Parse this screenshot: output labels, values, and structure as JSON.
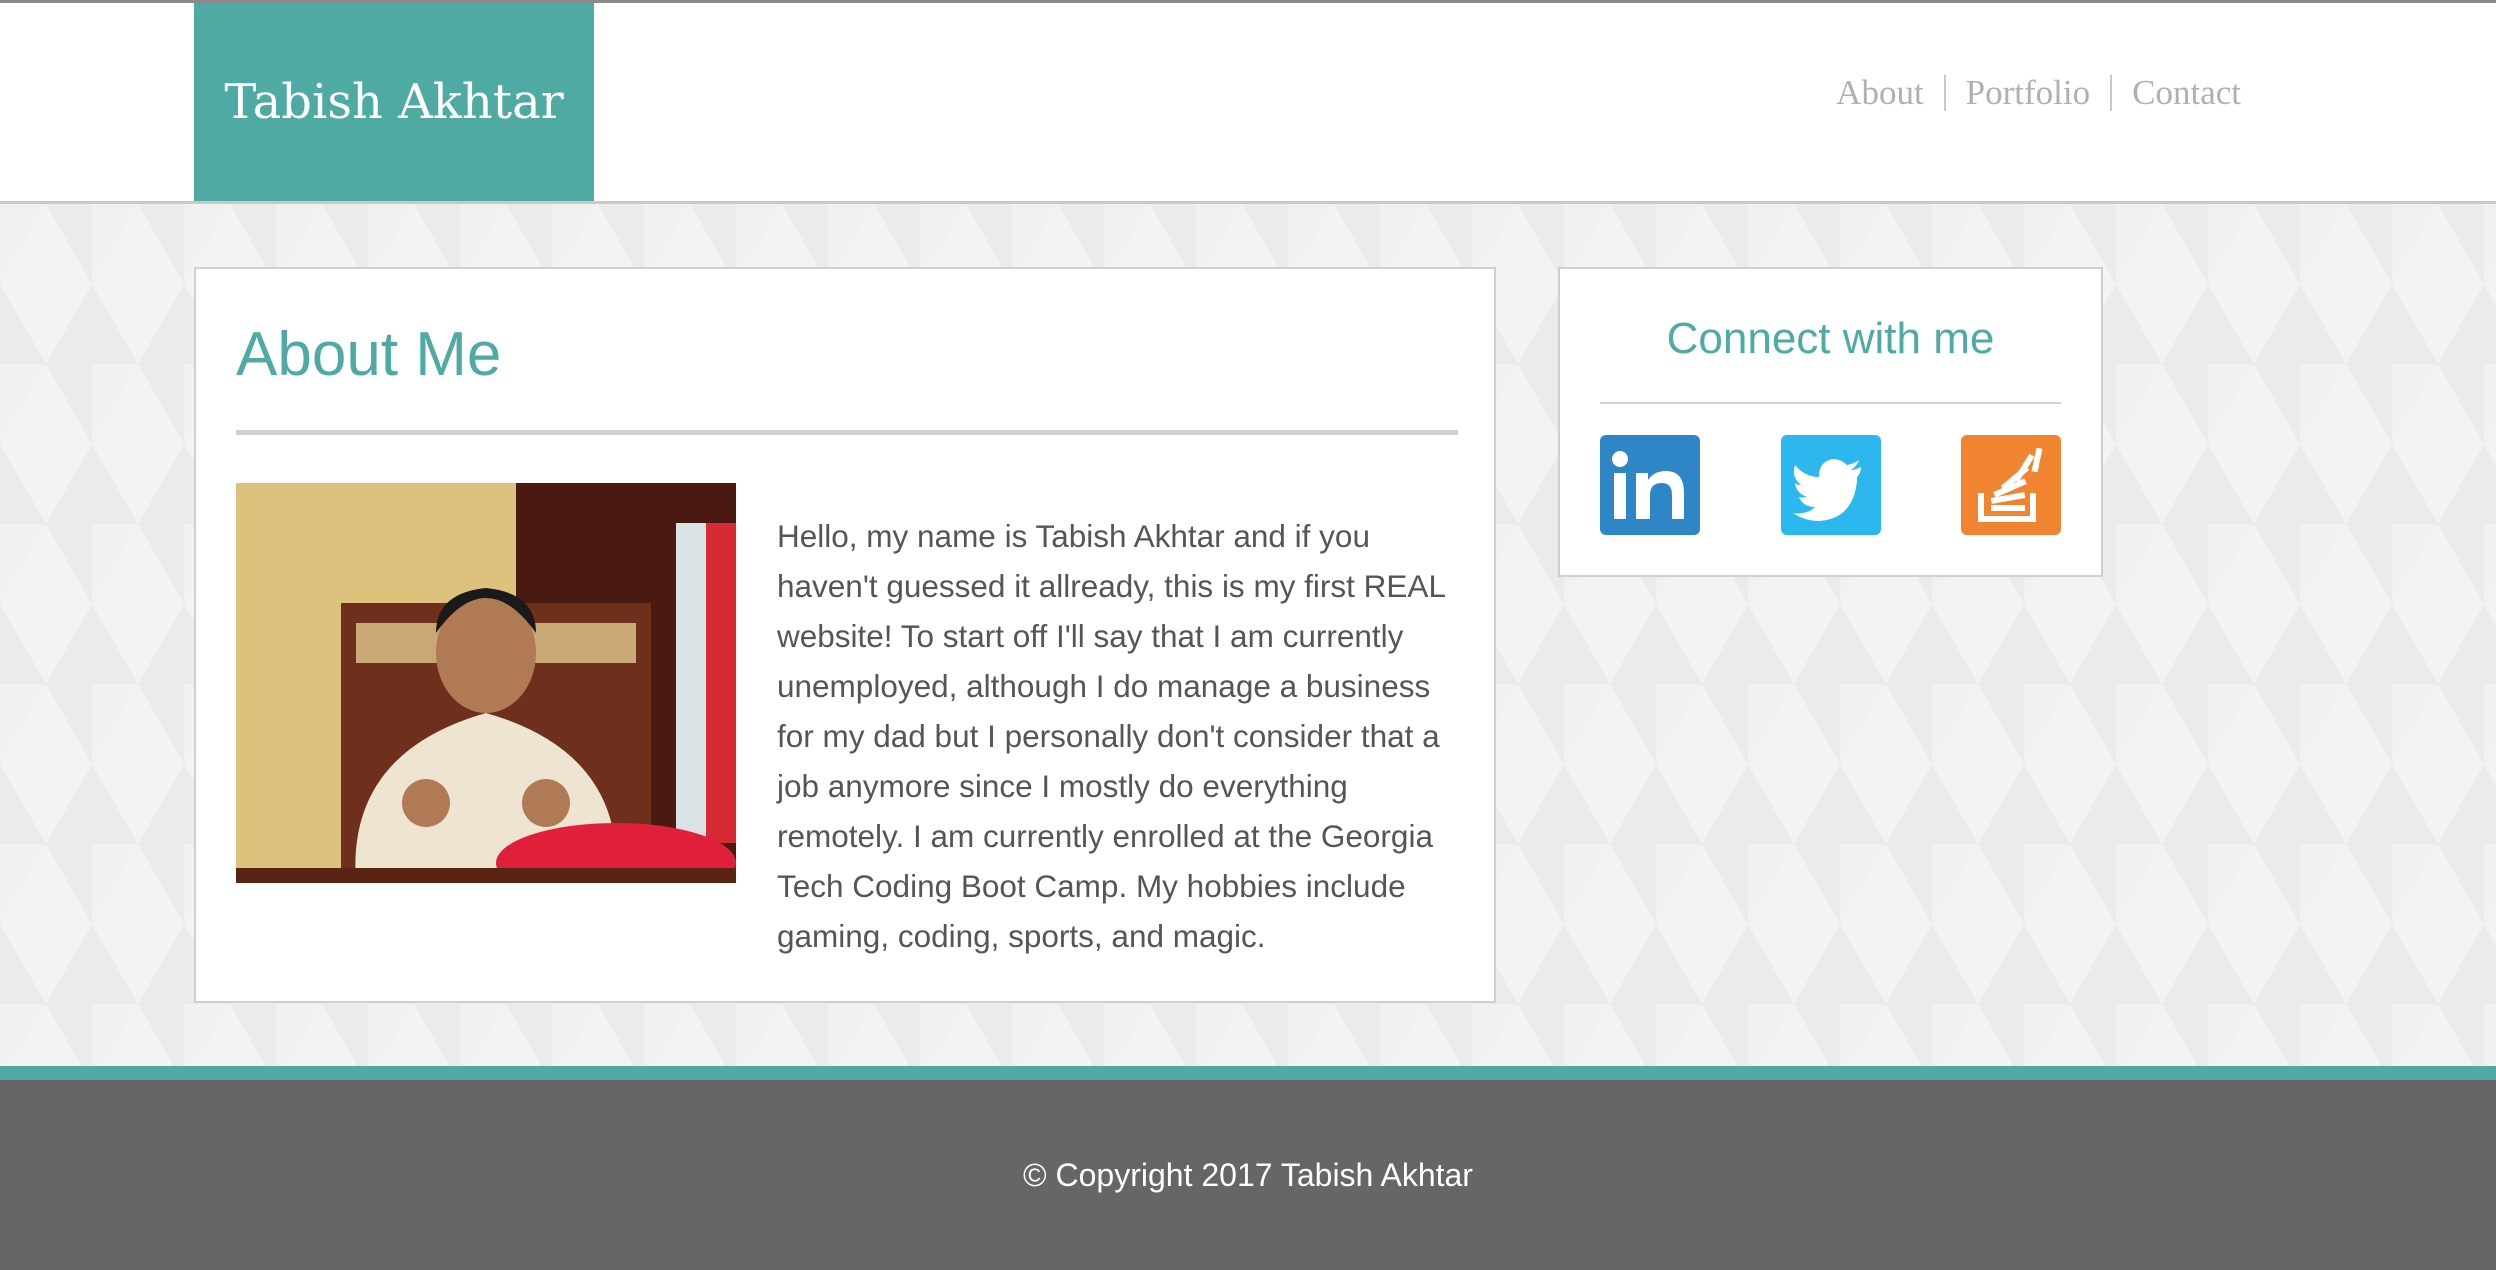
{
  "header": {
    "brand": "Tabish Akhtar",
    "nav": [
      {
        "label": "About"
      },
      {
        "label": "Portfolio"
      },
      {
        "label": "Contact"
      }
    ]
  },
  "about": {
    "title": "About Me",
    "photo_alt": "photo",
    "text": "Hello, my name is Tabish Akhtar and if you haven't guessed it allready, this is my first REAL website! To start off I'll say that I am currently unemployed, although I do manage a business for my dad but I personally don't consider that a job anymore since I mostly do everything remotely. I am currently enrolled at the Georgia Tech Coding Boot Camp. My hobbies include gaming, coding, sports, and magic."
  },
  "connect": {
    "title": "Connect with me",
    "icons": [
      {
        "name": "linkedin-icon",
        "color": "#2f86c7"
      },
      {
        "name": "twitter-icon",
        "color": "#2cb8ee"
      },
      {
        "name": "stackoverflow-icon",
        "color": "#f18431"
      }
    ]
  },
  "footer": {
    "copyright": "© Copyright 2017 Tabish Akhtar"
  },
  "colors": {
    "accent": "#4eaaa3",
    "footer": "#666666"
  }
}
